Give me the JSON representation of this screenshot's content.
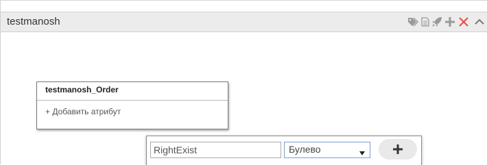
{
  "panel": {
    "title": "testmanosh",
    "icons": [
      "tags-icon",
      "document-icon",
      "rocket-icon",
      "plus-icon",
      "close-icon",
      "collapse-chevron-icon"
    ],
    "colors": {
      "header_bg": "#ececec",
      "icon_gray": "#9a9a9a",
      "close_red": "#e84c3d"
    }
  },
  "entity": {
    "title": "testmanosh_Order",
    "add_attribute_label": "+ Добавить атрибут"
  },
  "attribute_form": {
    "name_value": "RightExist",
    "type_selected": "Булево",
    "add_button_icon": "plus-icon"
  }
}
